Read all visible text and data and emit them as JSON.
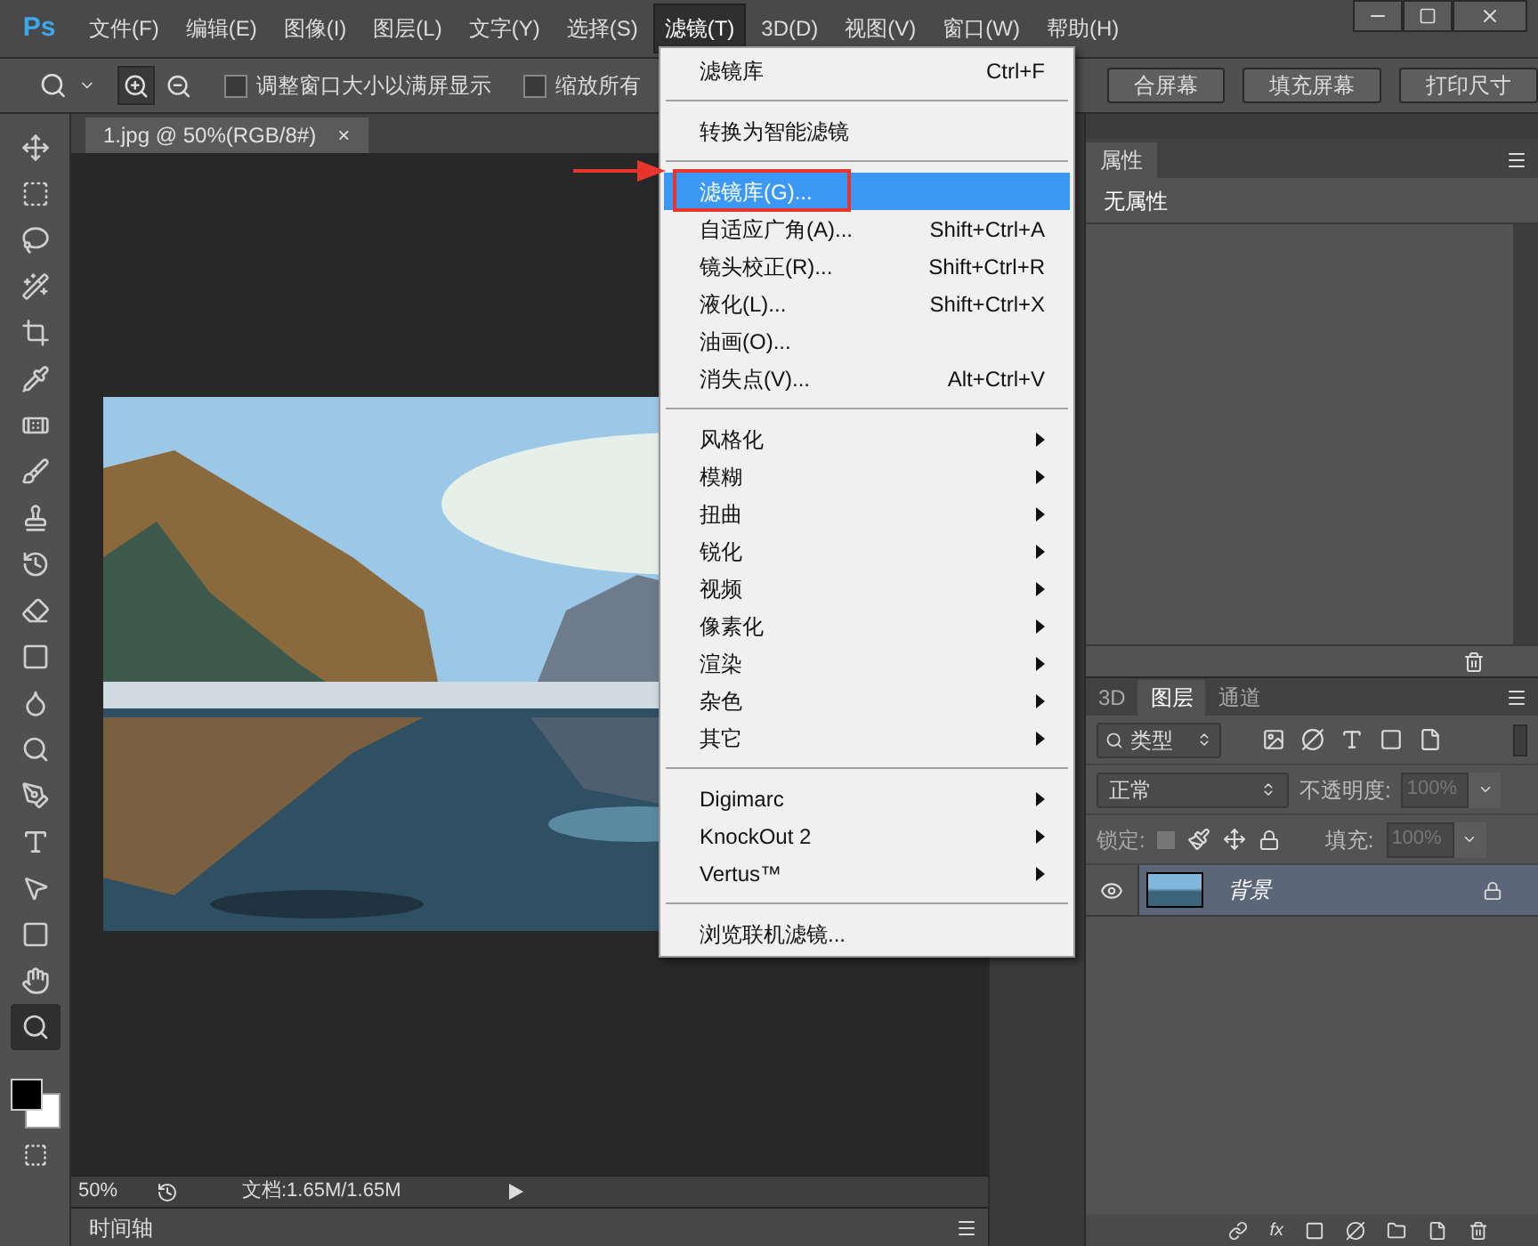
{
  "menu_bar": {
    "logo": "Ps",
    "items": [
      {
        "label": "文件(F)",
        "selected": false
      },
      {
        "label": "编辑(E)",
        "selected": false
      },
      {
        "label": "图像(I)",
        "selected": false
      },
      {
        "label": "图层(L)",
        "selected": false
      },
      {
        "label": "文字(Y)",
        "selected": false
      },
      {
        "label": "选择(S)",
        "selected": false
      },
      {
        "label": "滤镜(T)",
        "selected": true
      },
      {
        "label": "3D(D)",
        "selected": false
      },
      {
        "label": "视图(V)",
        "selected": false
      },
      {
        "label": "窗口(W)",
        "selected": false
      },
      {
        "label": "帮助(H)",
        "selected": false
      }
    ]
  },
  "options_bar": {
    "checkboxes": [
      {
        "label": "调整窗口大小以满屏显示",
        "checked": false
      },
      {
        "label": "缩放所有",
        "checked": false
      }
    ],
    "buttons": [
      "合屏幕",
      "填充屏幕",
      "打印尺寸"
    ]
  },
  "document_tab": {
    "title": "1.jpg @ 50%(RGB/8#)",
    "close": "×"
  },
  "status_bar": {
    "zoom": "50%",
    "doc_info": "文档:1.65M/1.65M"
  },
  "timeline_tab": "时间轴",
  "properties_panel": {
    "tab": "属性",
    "message": "无属性"
  },
  "layers_panel": {
    "tabs": [
      {
        "label": "3D",
        "selected": false
      },
      {
        "label": "图层",
        "selected": true
      },
      {
        "label": "通道",
        "selected": false
      }
    ],
    "filter": "类型",
    "blend_mode": "正常",
    "opacity_label": "不透明度:",
    "opacity": "100%",
    "lock_label": "锁定:",
    "fill_label": "填充:",
    "fill": "100%",
    "fx_label": "fx",
    "layers": [
      {
        "name": "背景",
        "visible": true,
        "selected": true
      }
    ]
  },
  "filter_menu": {
    "items": [
      {
        "kind": "item",
        "label": "滤镜库",
        "shortcut": "Ctrl+F",
        "selected": false,
        "outlined": false
      },
      {
        "kind": "separator"
      },
      {
        "kind": "item",
        "label": "转换为智能滤镜",
        "selected": false,
        "outlined": false
      },
      {
        "kind": "separator"
      },
      {
        "kind": "item",
        "label": "滤镜库(G)...",
        "selected": true,
        "outlined": true
      },
      {
        "kind": "item",
        "label": "自适应广角(A)...",
        "shortcut": "Shift+Ctrl+A",
        "selected": false,
        "outlined": false
      },
      {
        "kind": "item",
        "label": "镜头校正(R)...",
        "shortcut": "Shift+Ctrl+R",
        "selected": false,
        "outlined": false
      },
      {
        "kind": "item",
        "label": "液化(L)...",
        "shortcut": "Shift+Ctrl+X",
        "selected": false,
        "outlined": false
      },
      {
        "kind": "item",
        "label": "油画(O)...",
        "selected": false,
        "outlined": false
      },
      {
        "kind": "item",
        "label": "消失点(V)...",
        "shortcut": "Alt+Ctrl+V",
        "selected": false,
        "outlined": false
      },
      {
        "kind": "separator"
      },
      {
        "kind": "submenu",
        "label": "风格化",
        "selected": false,
        "outlined": false
      },
      {
        "kind": "submenu",
        "label": "模糊",
        "selected": false,
        "outlined": false
      },
      {
        "kind": "submenu",
        "label": "扭曲",
        "selected": false,
        "outlined": false
      },
      {
        "kind": "submenu",
        "label": "锐化",
        "selected": false,
        "outlined": false
      },
      {
        "kind": "submenu",
        "label": "视频",
        "selected": false,
        "outlined": false
      },
      {
        "kind": "submenu",
        "label": "像素化",
        "selected": false,
        "outlined": false
      },
      {
        "kind": "submenu",
        "label": "渲染",
        "selected": false,
        "outlined": false
      },
      {
        "kind": "submenu",
        "label": "杂色",
        "selected": false,
        "outlined": false
      },
      {
        "kind": "submenu",
        "label": "其它",
        "selected": false,
        "outlined": false
      },
      {
        "kind": "separator"
      },
      {
        "kind": "submenu",
        "label": "Digimarc",
        "selected": false,
        "outlined": false
      },
      {
        "kind": "submenu",
        "label": "KnockOut 2",
        "selected": false,
        "outlined": false
      },
      {
        "kind": "submenu",
        "label": "Vertus™",
        "selected": false,
        "outlined": false
      },
      {
        "kind": "separator"
      },
      {
        "kind": "item",
        "label": "浏览联机滤镜...",
        "selected": false,
        "outlined": false
      }
    ]
  }
}
